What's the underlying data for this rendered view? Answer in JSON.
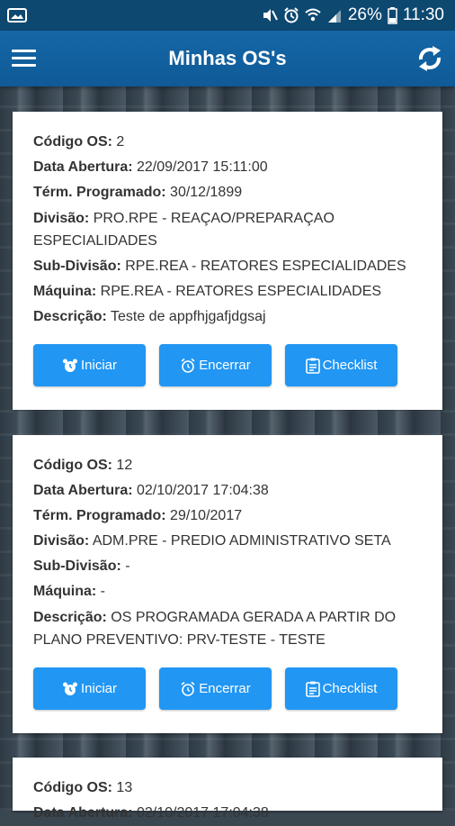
{
  "status_bar": {
    "battery": "26%",
    "time": "11:30"
  },
  "app_bar": {
    "title": "Minhas OS's"
  },
  "labels": {
    "codigo": "Código OS:",
    "data_abertura": "Data Abertura:",
    "term_programado": "Térm. Programado:",
    "divisao": "Divisão:",
    "sub_divisao": "Sub-Divisão:",
    "maquina": "Máquina:",
    "descricao": "Descrição:"
  },
  "buttons": {
    "iniciar": "Iniciar",
    "encerrar": "Encerrar",
    "checklist": "Checklist"
  },
  "orders": [
    {
      "codigo": " 2",
      "data_abertura": " 22/09/2017 15:11:00",
      "term_programado": " 30/12/1899",
      "divisao": " PRO.RPE - REAÇAO/PREPARAÇAO ESPECIALIDADES",
      "sub_divisao": " RPE.REA - REATORES ESPECIALIDADES",
      "maquina": " RPE.REA - REATORES ESPECIALIDADES",
      "descricao": " Teste de appfhjgafjdgsaj"
    },
    {
      "codigo": " 12",
      "data_abertura": " 02/10/2017 17:04:38",
      "term_programado": " 29/10/2017",
      "divisao": " ADM.PRE - PREDIO ADMINISTRATIVO SETA",
      "sub_divisao": " -",
      "maquina": " -",
      "descricao": " OS PROGRAMADA GERADA A PARTIR DO PLANO PREVENTIVO: PRV-TESTE - TESTE"
    },
    {
      "codigo": " 13",
      "data_abertura": " 02/10/2017 17:04:38"
    }
  ]
}
